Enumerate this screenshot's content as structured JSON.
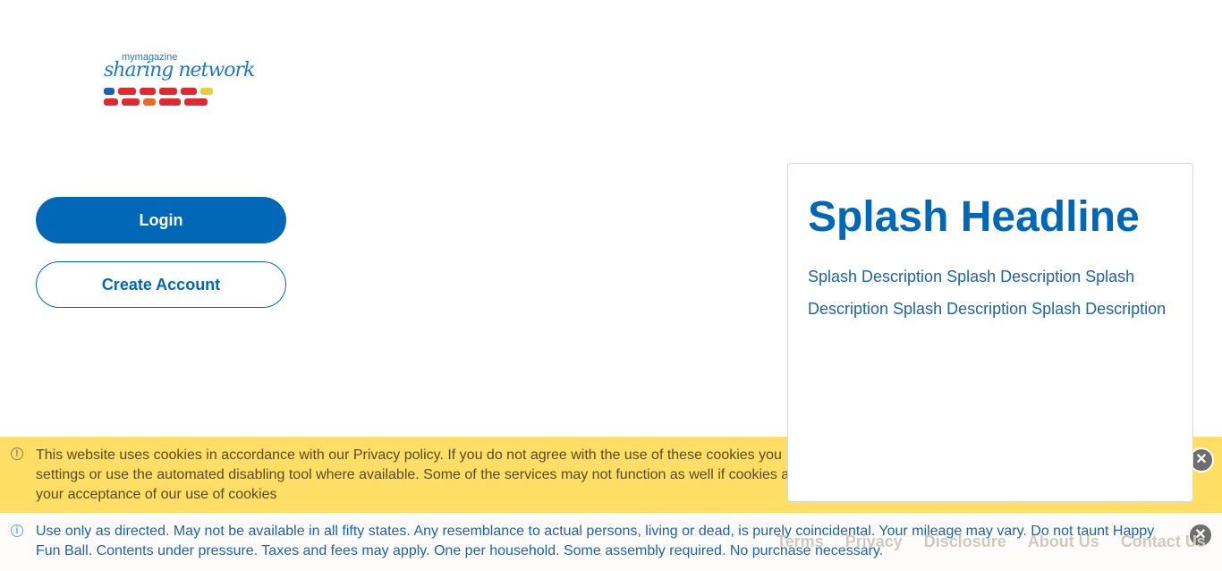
{
  "logo": {
    "line1": "mymagazine",
    "line2": "sharing network"
  },
  "auth": {
    "login_label": "Login",
    "create_label": "Create Account"
  },
  "splash": {
    "headline": "Splash Headline",
    "description": "Splash Description Splash Description Splash Description Splash Description Splash Description"
  },
  "footer": {
    "links": [
      "Terms",
      "Privacy",
      "Disclosure",
      "About Us",
      "Contact Us"
    ]
  },
  "cookie_banner": {
    "icon": "exclamation-circle-icon",
    "lines": [
      "This website uses cookies in accordance with our Privacy policy. If you do not agree with the use of these cookies you",
      "settings or use the automated disabling tool where available. Some of the services may not function as well if cookies a",
      "your acceptance of our use of cookies"
    ],
    "close_icon": "close-circle-icon",
    "bg": "#ffde66"
  },
  "info_banner": {
    "icon": "info-circle-icon",
    "text": "Use only as directed. May not be available in all fifty states. Any resemblance to actual persons, living or dead, is purely coincidental. Your mileage may vary. Do not taunt Happy Fun Ball. Contents under pressure. Taxes and fees may apply. One per household. Some assembly required. No purchase necessary.",
    "close_icon": "close-circle-icon"
  },
  "colors": {
    "brand": "#0068b6"
  }
}
